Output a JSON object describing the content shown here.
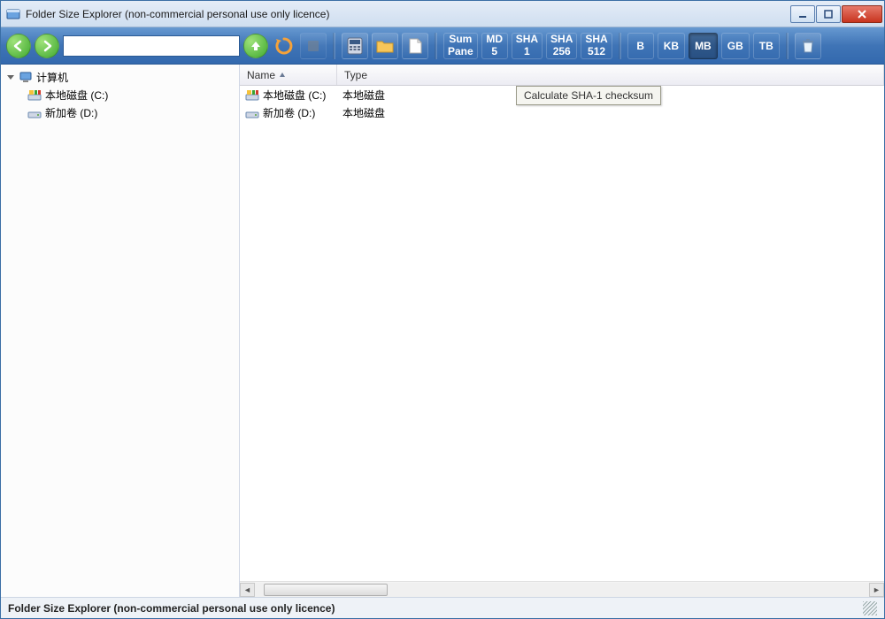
{
  "window": {
    "title": "Folder Size Explorer (non-commercial personal use only licence)"
  },
  "toolbar": {
    "address_value": "",
    "sum_pane": {
      "line1": "Sum",
      "line2": "Pane"
    },
    "md5": {
      "line1": "MD",
      "line2": "5"
    },
    "sha1": {
      "line1": "SHA",
      "line2": "1"
    },
    "sha256": {
      "line1": "SHA",
      "line2": "256"
    },
    "sha512": {
      "line1": "SHA",
      "line2": "512"
    },
    "units": {
      "b": "B",
      "kb": "KB",
      "mb": "MB",
      "gb": "GB",
      "tb": "TB"
    }
  },
  "tooltip": "Calculate SHA-1 checksum",
  "sidebar": {
    "root": "计算机",
    "items": [
      {
        "label": "本地磁盘 (C:)"
      },
      {
        "label": "新加卷 (D:)"
      }
    ]
  },
  "columns": {
    "name": "Name",
    "type": "Type"
  },
  "rows": [
    {
      "name": "本地磁盘 (C:)",
      "type": "本地磁盘",
      "icon": "drive-c"
    },
    {
      "name": "新加卷 (D:)",
      "type": "本地磁盘",
      "icon": "drive-d"
    }
  ],
  "statusbar": "Folder Size Explorer (non-commercial personal use only licence)"
}
